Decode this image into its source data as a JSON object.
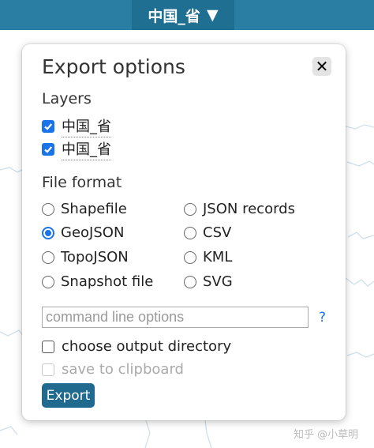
{
  "topbar": {
    "layer_name": "中国_省",
    "dropdown_glyph": "▼"
  },
  "dialog": {
    "title": "Export options",
    "close_glyph": "✕",
    "layers_heading": "Layers",
    "layers": [
      {
        "name": "中国_省",
        "checked": true
      },
      {
        "name": "中国_省",
        "checked": true
      }
    ],
    "format_heading": "File format",
    "formats": [
      {
        "label": "Shapefile",
        "selected": false
      },
      {
        "label": "GeoJSON",
        "selected": true
      },
      {
        "label": "TopoJSON",
        "selected": false
      },
      {
        "label": "Snapshot file",
        "selected": false
      },
      {
        "label": "JSON records",
        "selected": false
      },
      {
        "label": "CSV",
        "selected": false
      },
      {
        "label": "KML",
        "selected": false
      },
      {
        "label": "SVG",
        "selected": false
      }
    ],
    "command_placeholder": "command line options",
    "help_label": "?",
    "choose_dir_label": "choose output directory",
    "choose_dir_checked": false,
    "clipboard_label": "save to clipboard",
    "clipboard_enabled": false,
    "export_label": "Export"
  },
  "watermark": "知乎 @小草明",
  "colors": {
    "topbar": "#2a7ea3",
    "accent": "#1a73e8",
    "export_button": "#1f6a8e"
  }
}
